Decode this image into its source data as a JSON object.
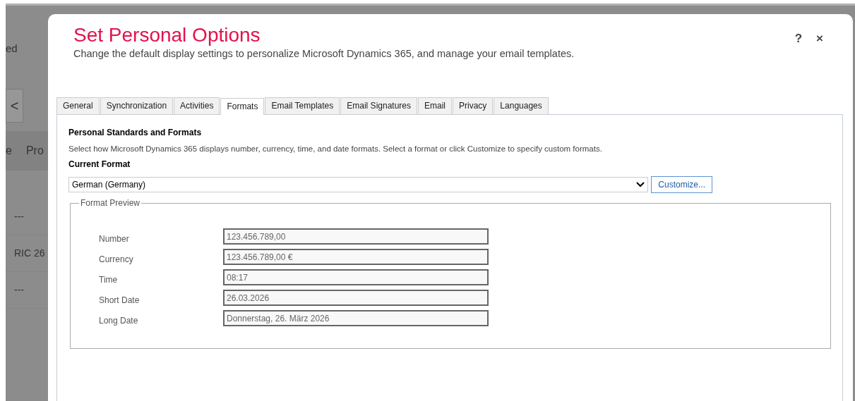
{
  "background": {
    "header_fragment": "ed",
    "back_button": "<",
    "nav_fragments": [
      "e",
      "Pro"
    ],
    "rows": [
      "---",
      "RIC 26",
      "---"
    ]
  },
  "dialog": {
    "title": "Set Personal Options",
    "subtitle": "Change the default display settings to personalize Microsoft Dynamics 365, and manage your email templates.",
    "help": "?",
    "close": "×"
  },
  "tabs": [
    {
      "label": "General",
      "selected": false
    },
    {
      "label": "Synchronization",
      "selected": false
    },
    {
      "label": "Activities",
      "selected": false
    },
    {
      "label": "Formats",
      "selected": true
    },
    {
      "label": "Email Templates",
      "selected": false
    },
    {
      "label": "Email Signatures",
      "selected": false
    },
    {
      "label": "Email",
      "selected": false
    },
    {
      "label": "Privacy",
      "selected": false
    },
    {
      "label": "Languages",
      "selected": false
    }
  ],
  "section": {
    "heading": "Personal Standards and Formats",
    "description": "Select how Microsoft Dynamics 365 displays number, currency, time, and date formats. Select a format or click Customize to specify custom formats.",
    "current_format_label": "Current Format",
    "current_format": "German (Germany)",
    "customize_button": "Customize..."
  },
  "preview": {
    "legend": "Format Preview",
    "fields": [
      {
        "label": "Number",
        "value": "123.456.789,00"
      },
      {
        "label": "Currency",
        "value": "123.456.789,00 €"
      },
      {
        "label": "Time",
        "value": "08:17"
      },
      {
        "label": "Short Date",
        "value": "26.03.2026"
      },
      {
        "label": "Long Date",
        "value": "Donnerstag, 26. März 2026"
      }
    ]
  }
}
